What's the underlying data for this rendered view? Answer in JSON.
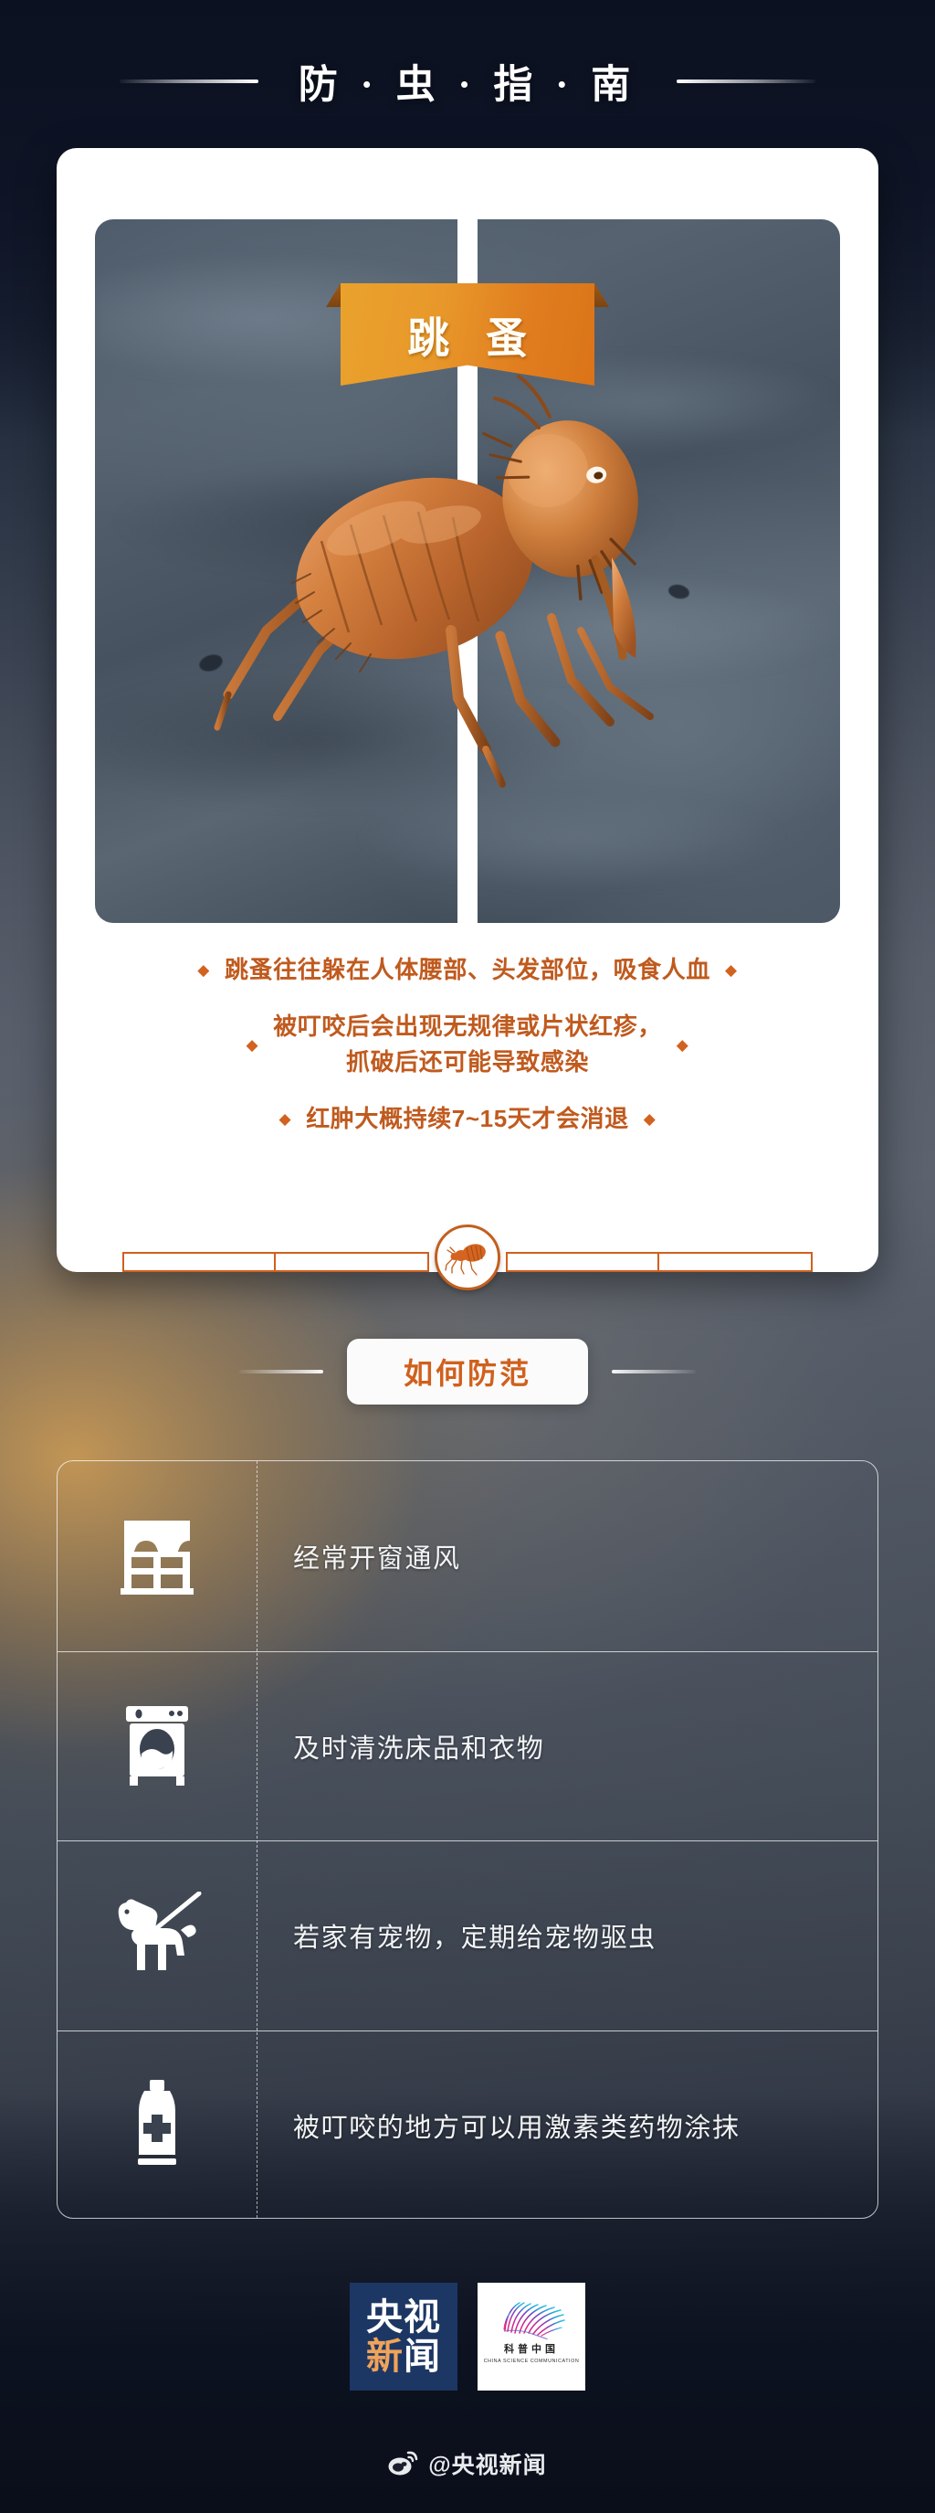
{
  "header": {
    "title": "防 · 虫 · 指 · 南"
  },
  "card": {
    "ribbon_label": "跳 蚤",
    "photo_alt": "flea-photo",
    "description": [
      {
        "text": "跳蚤往往躲在人体腰部、头发部位，吸食人血",
        "bullets": "both",
        "lines": [
          "跳蚤往往躲在人体腰部、头发部位，吸食人血"
        ]
      },
      {
        "text": "被叮咬后会出现无规律或片状红疹，抓破后还可能导致感染",
        "bullets": "both",
        "lines": [
          "被叮咬后会出现无规律或片状红疹，",
          "抓破后还可能导致感染"
        ]
      },
      {
        "text": "红肿大概持续7~15天才会消退",
        "bullets": "both",
        "lines": [
          "红肿大概持续7~15天才会消退"
        ]
      }
    ],
    "desc_1_line1": "跳蚤往往躲在人体腰部、头发部位，吸食人血",
    "desc_2_line1": "被叮咬后会出现无规律或片状红疹，",
    "desc_2_line2": "抓破后还可能导致感染",
    "desc_3_line1": "红肿大概持续7~15天才会消退",
    "bullet_glyph": "◆"
  },
  "section": {
    "title": "如何防范"
  },
  "prevention": {
    "items": [
      {
        "icon": "window-icon",
        "label": "经常开窗通风"
      },
      {
        "icon": "washing-machine-icon",
        "label": "及时清洗床品和衣物"
      },
      {
        "icon": "dog-on-leash-icon",
        "label": "若家有宠物，定期给宠物驱虫"
      },
      {
        "icon": "ointment-tube-icon",
        "label": "被叮咬的地方可以用激素类药物涂抹"
      }
    ]
  },
  "footer": {
    "logo_cctv_line1": "央视",
    "logo_cctv_line2_a": "新",
    "logo_cctv_line2_b": "闻",
    "logo_kepu_cn": "科普中国",
    "logo_kepu_en": "CHINA SCIENCE COMMUNICATION",
    "weibo_handle": "@央视新闻"
  },
  "colors": {
    "orange": "#d0601d",
    "ribbon_orange": "#e8982a",
    "cctv_blue": "#1d3764",
    "text_white": "#f2f4f6"
  }
}
